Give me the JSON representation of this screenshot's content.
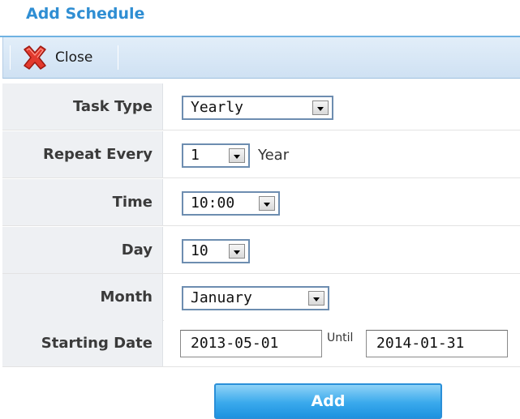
{
  "dialog": {
    "title": "Add Schedule"
  },
  "toolbar": {
    "close_label": "Close",
    "close_icon": "close-x-icon"
  },
  "form": {
    "task_type": {
      "label": "Task Type",
      "value": "Yearly"
    },
    "repeat_every": {
      "label": "Repeat Every",
      "value": "1",
      "unit": "Year"
    },
    "time": {
      "label": "Time",
      "value": "10:00"
    },
    "day": {
      "label": "Day",
      "value": "10"
    },
    "month": {
      "label": "Month",
      "value": "January"
    },
    "starting_date": {
      "label": "Starting Date",
      "start_value": "2013-05-01",
      "until_label": "Until",
      "end_value": "2014-01-31"
    }
  },
  "actions": {
    "add_label": "Add"
  },
  "colors": {
    "title": "#2f8ed3",
    "label_bg": "#eef0f3",
    "button_accent": "#2a8fd8"
  }
}
